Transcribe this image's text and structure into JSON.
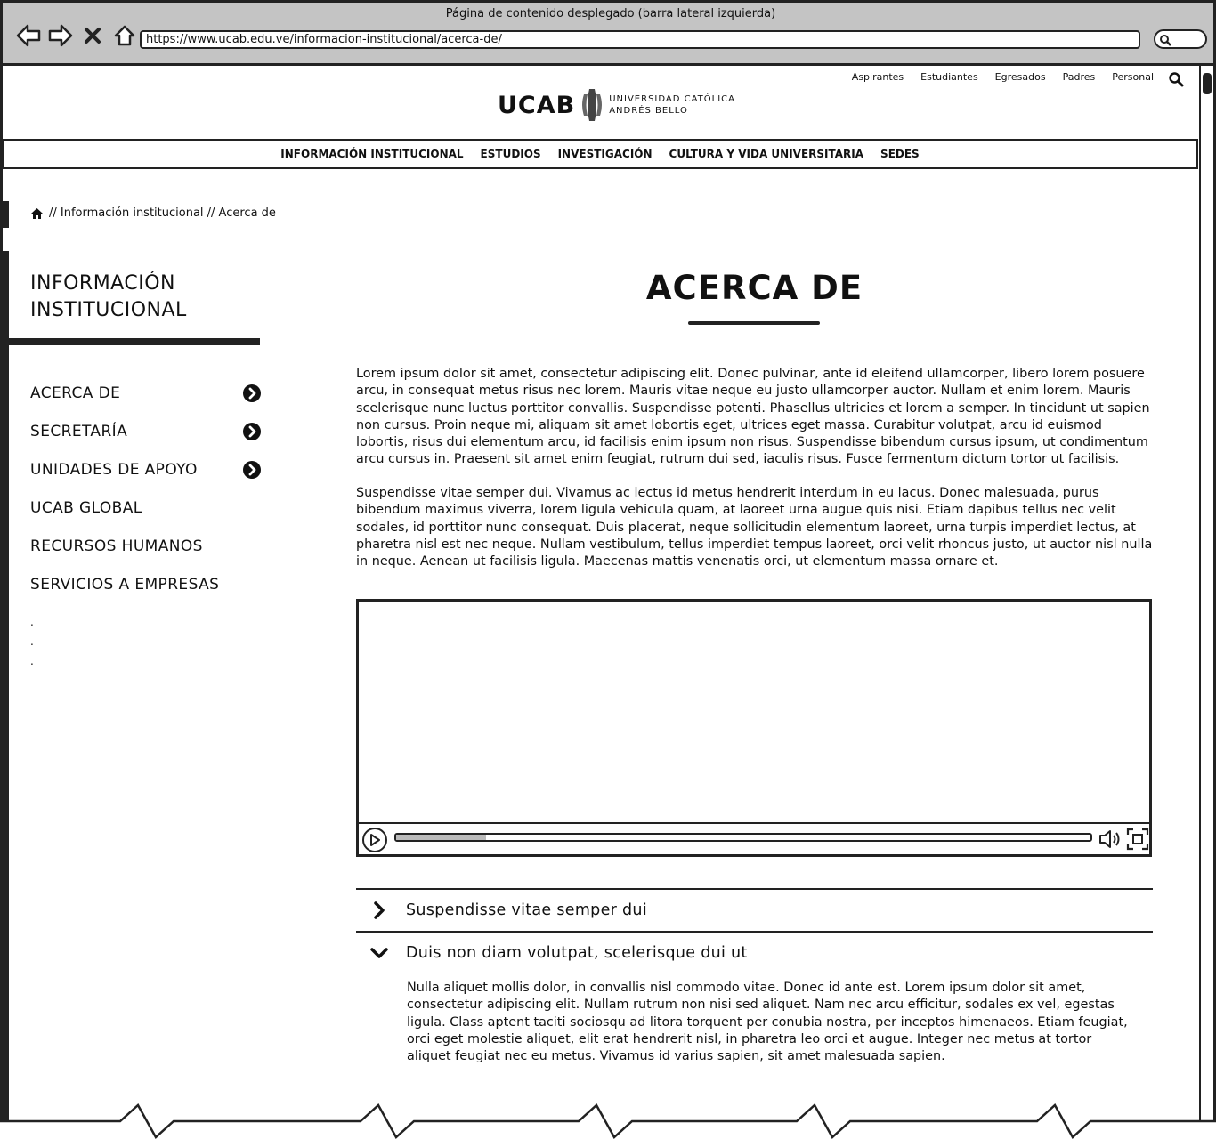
{
  "browser": {
    "window_title": "Página de contenido desplegado (barra lateral izquierda)",
    "url": "https://www.ucab.edu.ve/informacion-institucional/acerca-de/"
  },
  "header": {
    "util_links": [
      "Aspirantes",
      "Estudiantes",
      "Egresados",
      "Padres",
      "Personal"
    ],
    "logo_text": "UCAB",
    "logo_sub_1": "UNIVERSIDAD CATÓLICA",
    "logo_sub_2": "ANDRÉS BELLO"
  },
  "mainnav": [
    "INFORMACIÓN INSTITUCIONAL",
    "ESTUDIOS",
    "INVESTIGACIÓN",
    "CULTURA Y VIDA UNIVERSITARIA",
    "SEDES"
  ],
  "breadcrumb": "// Información institucional // Acerca de",
  "sidebar": {
    "title_line1": "INFORMACIÓN",
    "title_line2": "INSTITUCIONAL",
    "items": [
      {
        "label": "ACERCA DE",
        "has_arrow": true
      },
      {
        "label": "SECRETARÍA",
        "has_arrow": true
      },
      {
        "label": "UNIDADES DE APOYO",
        "has_arrow": true
      },
      {
        "label": "UCAB GLOBAL",
        "has_arrow": false
      },
      {
        "label": "RECURSOS HUMANOS",
        "has_arrow": false
      },
      {
        "label": "SERVICIOS A EMPRESAS",
        "has_arrow": false
      }
    ],
    "dots": [
      ".",
      ".",
      "."
    ]
  },
  "content": {
    "title": "ACERCA DE",
    "paragraph1": "Lorem ipsum dolor sit amet, consectetur adipiscing elit. Donec pulvinar, ante id eleifend ullamcorper, libero lorem posuere arcu, in consequat metus risus nec lorem. Mauris vitae neque eu justo ullamcorper auctor. Nullam et enim lorem. Mauris scelerisque nunc luctus porttitor convallis. Suspendisse potenti. Phasellus ultricies et lorem a semper. In tincidunt ut sapien non cursus. Proin neque mi, aliquam sit amet lobortis eget, ultrices eget massa. Curabitur volutpat, arcu id euismod lobortis, risus dui elementum arcu, id facilisis enim ipsum non risus. Suspendisse bibendum cursus ipsum, ut condimentum arcu cursus in. Praesent sit amet enim feugiat, rutrum dui sed, iaculis risus. Fusce fermentum dictum tortor ut facilisis.",
    "paragraph2": "Suspendisse vitae semper dui. Vivamus ac lectus id metus hendrerit interdum in eu lacus. Donec malesuada, purus bibendum maximus viverra, lorem ligula vehicula quam, at laoreet urna augue quis nisi. Etiam dapibus tellus nec velit sodales, id porttitor nunc consequat. Duis placerat, neque sollicitudin elementum laoreet, urna turpis imperdiet lectus, at pharetra nisl est nec neque. Nullam vestibulum, tellus imperdiet tempus laoreet, orci velit rhoncus justo, ut auctor nisl nulla in neque. Aenean ut facilisis ligula. Maecenas mattis venenatis orci, ut elementum massa ornare et.",
    "video": {
      "progress_fraction": 0.13
    },
    "accordion": [
      {
        "title": "Suspendisse vitae semper dui",
        "expanded": false
      },
      {
        "title": "Duis non diam volutpat, scelerisque dui ut",
        "expanded": true,
        "body": "Nulla aliquet mollis dolor, in convallis nisl commodo vitae. Donec id ante est. Lorem ipsum dolor sit amet, consectetur adipiscing elit. Nullam rutrum non nisi sed aliquet. Nam nec arcu efficitur, sodales ex vel, egestas ligula. Class aptent taciti sociosqu ad litora torquent per conubia nostra, per inceptos himenaeos. Etiam feugiat, orci eget molestie aliquet, elit erat hendrerit nisl, in pharetra leo orci et augue. Integer nec metus at tortor aliquet feugiat nec eu metus. Vivamus id varius sapien, sit amet malesuada sapien."
      }
    ]
  }
}
